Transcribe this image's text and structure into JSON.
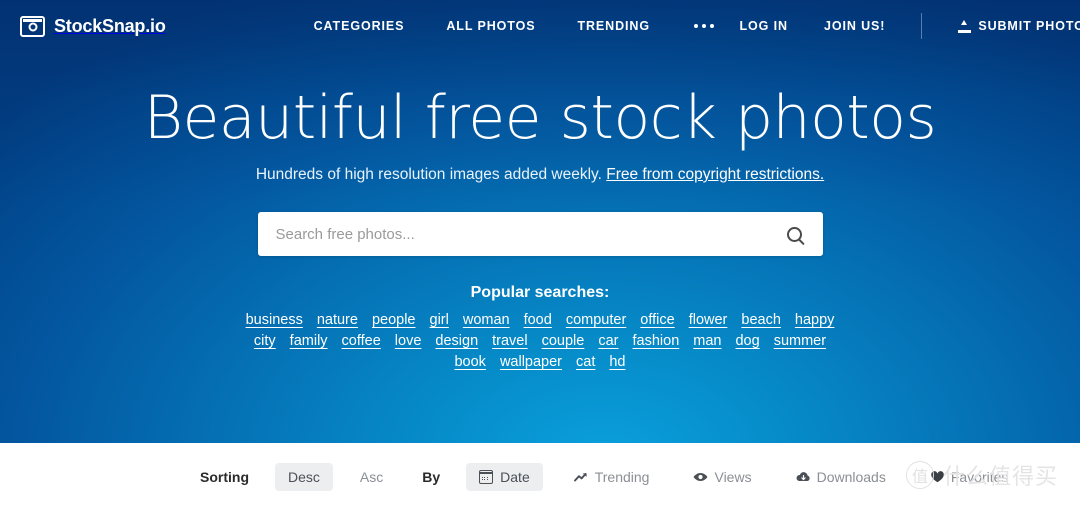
{
  "brand": {
    "name": "StockSnap.io",
    "logo_icon": "camera-icon"
  },
  "nav": {
    "center_links": [
      {
        "label": "CATEGORIES",
        "name": "categories"
      },
      {
        "label": "ALL PHOTOS",
        "name": "all-photos"
      },
      {
        "label": "TRENDING",
        "name": "trending"
      }
    ],
    "more_icon": "ellipsis-icon",
    "right_links": [
      {
        "label": "LOG IN",
        "name": "log-in"
      },
      {
        "label": "JOIN US!",
        "name": "join-us"
      }
    ],
    "submit": {
      "label": "SUBMIT PHOTOS",
      "icon": "upload-icon"
    }
  },
  "hero": {
    "headline": "Beautiful free stock photos",
    "subtitle_text": "Hundreds of high resolution images added weekly. ",
    "subtitle_link": "Free from copyright restrictions.",
    "search": {
      "placeholder": "Search free photos...",
      "value": "",
      "icon": "search-icon"
    },
    "popular_title": "Popular searches:",
    "tag_rows": [
      [
        "business",
        "nature",
        "people",
        "girl",
        "woman",
        "food",
        "computer",
        "office",
        "flower",
        "beach",
        "happy"
      ],
      [
        "city",
        "family",
        "coffee",
        "love",
        "design",
        "travel",
        "couple",
        "car",
        "fashion",
        "man",
        "dog",
        "summer"
      ],
      [
        "book",
        "wallpaper",
        "cat",
        "hd"
      ]
    ]
  },
  "toolbar": {
    "sorting_label": "Sorting",
    "desc_label": "Desc",
    "asc_label": "Asc",
    "by_label": "By",
    "date_label": "Date",
    "trending_label": "Trending",
    "views_label": "Views",
    "downloads_label": "Downloads",
    "favorites_label": "Favorites",
    "active_order": "Desc",
    "active_sort": "Date"
  },
  "watermark": {
    "badge": "值",
    "text": "什么值得买"
  },
  "colors": {
    "hero_light": "#0aa0dd",
    "hero_dark": "#023c80",
    "accent_white": "#ffffff",
    "toolbar_active_bg": "#eceef0",
    "toolbar_text": "#8b8f94"
  }
}
